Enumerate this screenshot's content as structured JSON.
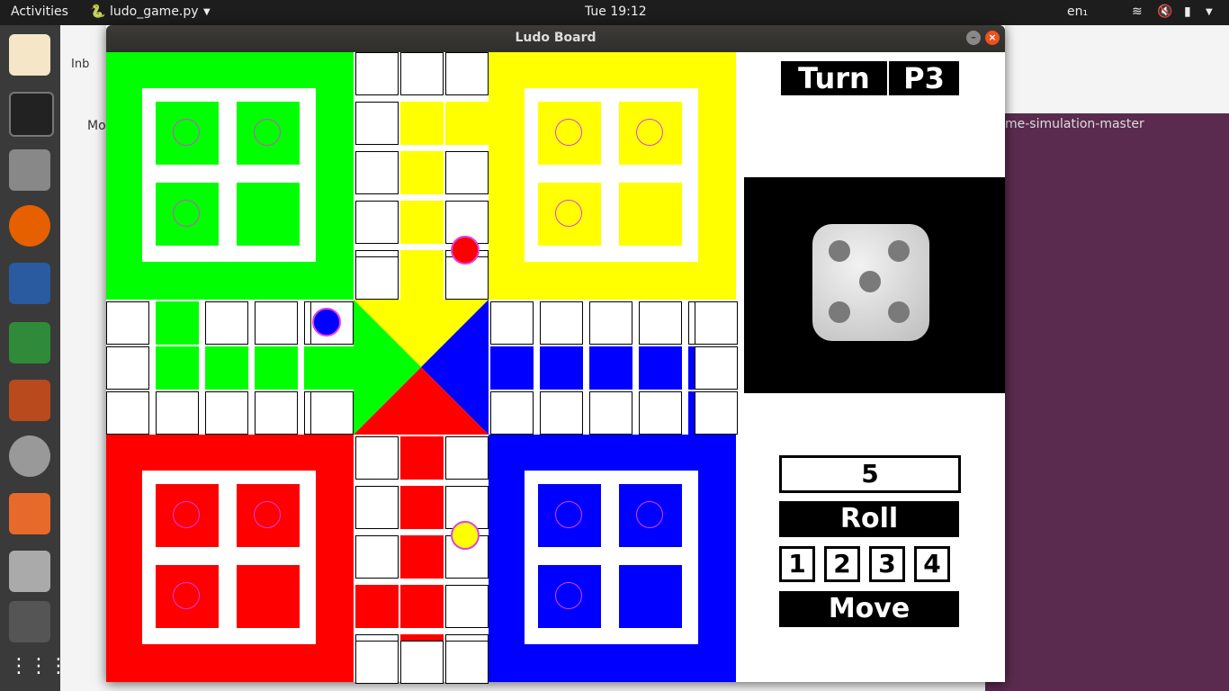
{
  "topbar": {
    "activities": "Activities",
    "app_name": "ludo_game.py",
    "clock": "Tue 19:12",
    "lang": "en₁"
  },
  "window": {
    "title": "Ludo Board"
  },
  "background_window": {
    "title_fragment": "me-simulation-master",
    "tab_fragment": "Inb",
    "menu_fragment": "Mo"
  },
  "board": {
    "colors": {
      "green": "#00ff00",
      "yellow": "#ffff00",
      "red": "#ff0000",
      "blue": "#0000ff",
      "ring": "#e040e0"
    }
  },
  "panel": {
    "turn_label": "Turn",
    "turn_player": "P3",
    "dice_value": "5",
    "roll_label": "Roll",
    "token_buttons": [
      "1",
      "2",
      "3",
      "4"
    ],
    "move_label": "Move"
  }
}
